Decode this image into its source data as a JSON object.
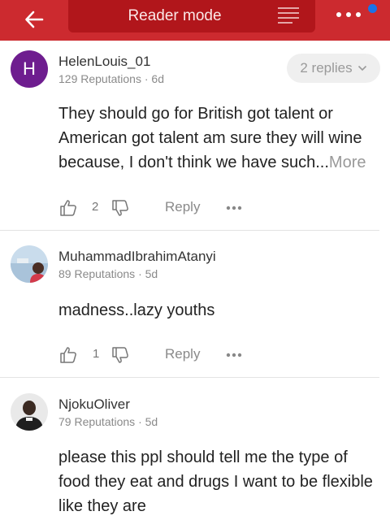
{
  "header": {
    "title": "Reader mode",
    "back_icon": "arrow-left-icon",
    "reader_icon": "reader-lines-icon",
    "more_icon": "more-dots-icon",
    "bar_color": "#cc2a2f",
    "pill_color": "#b1161b",
    "dot_color": "#1a73e8"
  },
  "comments": [
    {
      "avatar_letter": "H",
      "avatar_color": "#6e1d8f",
      "username": "HelenLouis_01",
      "meta": "129 Reputations · 6d",
      "replies_label": "2 replies",
      "text": "They should go for British got talent or American got talent am sure they will wine because, I don't think we have such...",
      "more_label": "More",
      "likes": "2",
      "reply_label": "Reply"
    },
    {
      "username": "MuhammadIbrahimAtanyi",
      "meta": "89 Reputations · 5d",
      "text": "madness..lazy youths",
      "likes": "1",
      "reply_label": "Reply"
    },
    {
      "username": "NjokuOliver",
      "meta": "79 Reputations · 5d",
      "text": "please this ppl should tell me the type of food they eat and drugs I want to be flexible like they are"
    }
  ]
}
